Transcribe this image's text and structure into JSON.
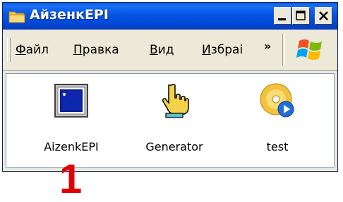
{
  "window": {
    "title": "АйзенкEPI",
    "controls": [
      "minimize",
      "maximize",
      "close"
    ]
  },
  "menubar": {
    "items": [
      {
        "first": "Ф",
        "rest": "айл"
      },
      {
        "first": "П",
        "rest": "равка"
      },
      {
        "first": "В",
        "rest": "ид"
      },
      {
        "first": "И",
        "rest": "збраі"
      }
    ],
    "chevron": "»"
  },
  "files": [
    {
      "label": "AizenkEPI",
      "icon": "application-window-icon"
    },
    {
      "label": "Generator",
      "icon": "hand-pointer-icon"
    },
    {
      "label": "test",
      "icon": "media-disc-icon"
    }
  ],
  "annotation": "1",
  "colors": {
    "titlebar": "#0054e3",
    "annotation": "#e00000"
  }
}
